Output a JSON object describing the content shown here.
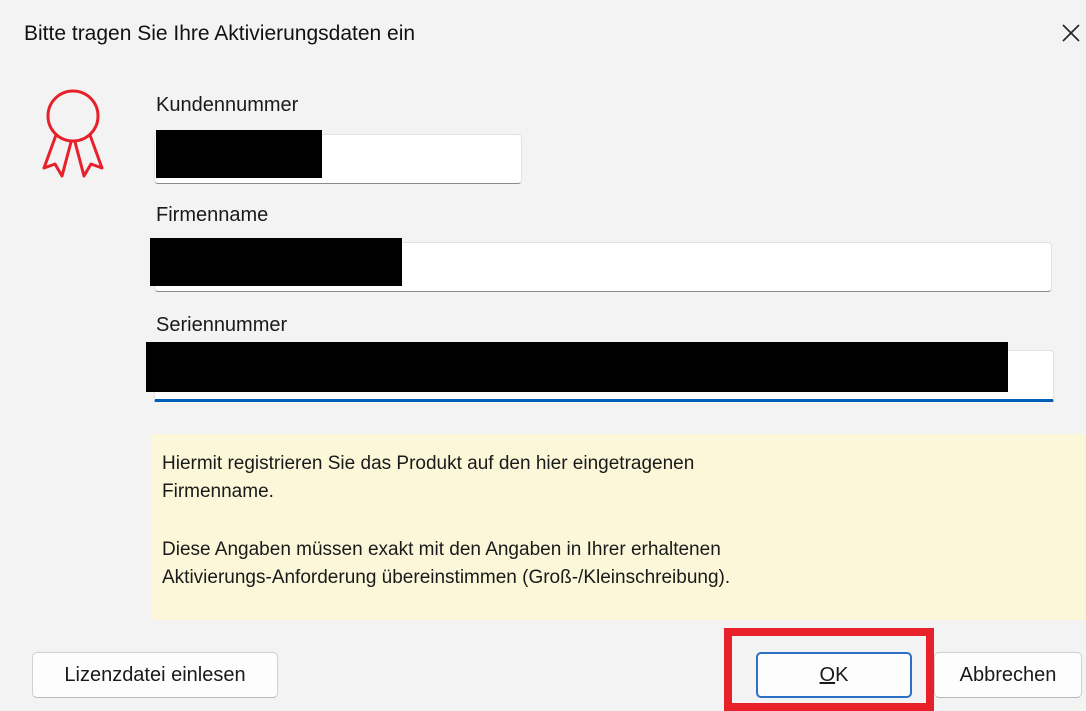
{
  "window": {
    "title": "Bitte tragen Sie Ihre Aktivierungsdaten ein",
    "close_icon": "close-icon"
  },
  "icon": "award-ribbon-icon",
  "accent_color": "#e8202a",
  "form": {
    "customer_number": {
      "label": "Kundennummer",
      "value": ""
    },
    "company_name": {
      "label": "Firmenname",
      "value": ""
    },
    "serial_number": {
      "label": "Seriennummer",
      "value": ""
    }
  },
  "info": {
    "paragraph1_line1": "Hiermit registrieren Sie das Produkt auf den hier eingetragenen",
    "paragraph1_line2": "Firmenname.",
    "paragraph2_line1": "Diese Angaben müssen exakt mit den Angaben in Ihrer erhaltenen",
    "paragraph2_line2": "Aktivierungs-Anforderung übereinstimmen (Groß-/Kleinschreibung)."
  },
  "buttons": {
    "load_license": "Lizenzdatei einlesen",
    "ok_mnemonic": "O",
    "ok_rest": "K",
    "cancel": "Abbrechen"
  }
}
